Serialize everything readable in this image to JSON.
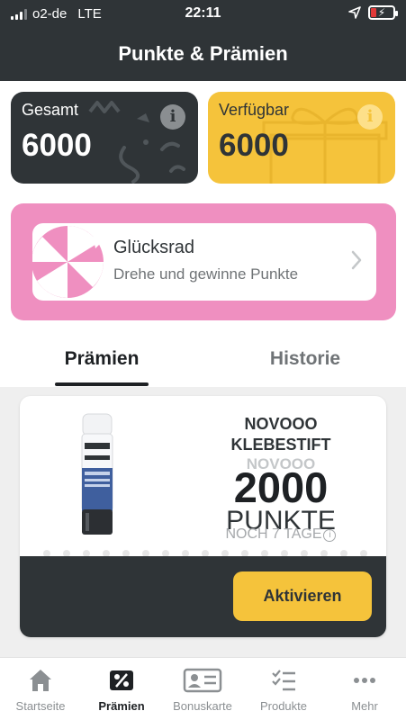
{
  "status_bar": {
    "carrier": "o2-de",
    "network": "LTE",
    "time": "22:11"
  },
  "header": {
    "title": "Punkte & Prämien"
  },
  "points": {
    "total": {
      "label": "Gesamt",
      "value": "6000"
    },
    "available": {
      "label": "Verfügbar",
      "value": "6000"
    }
  },
  "wheel": {
    "title": "Glücksrad",
    "subtitle": "Drehe und gewinne Punkte"
  },
  "tabs": [
    {
      "label": "Prämien",
      "active": true
    },
    {
      "label": "Historie",
      "active": false
    }
  ],
  "rewards": [
    {
      "name": "NOVOOO KLEBESTIFT",
      "brand": "NOVOOO",
      "points": "2000",
      "unit": "PUNKTE",
      "remaining": "NOCH 7 TAGE",
      "button": "Aktivieren",
      "image": "glue-stick-image"
    }
  ],
  "tab_bar": [
    {
      "label": "Startseite",
      "icon": "home-icon",
      "active": false
    },
    {
      "label": "Prämien",
      "icon": "percent-icon",
      "active": true
    },
    {
      "label": "Bonuskarte",
      "icon": "id-card-icon",
      "active": false
    },
    {
      "label": "Produkte",
      "icon": "checklist-icon",
      "active": false
    },
    {
      "label": "Mehr",
      "icon": "more-dots-icon",
      "active": false
    }
  ],
  "colors": {
    "dark": "#2f3437",
    "yellow": "#f5c33b",
    "pink": "#ef8fc0",
    "background": "#efefef"
  }
}
